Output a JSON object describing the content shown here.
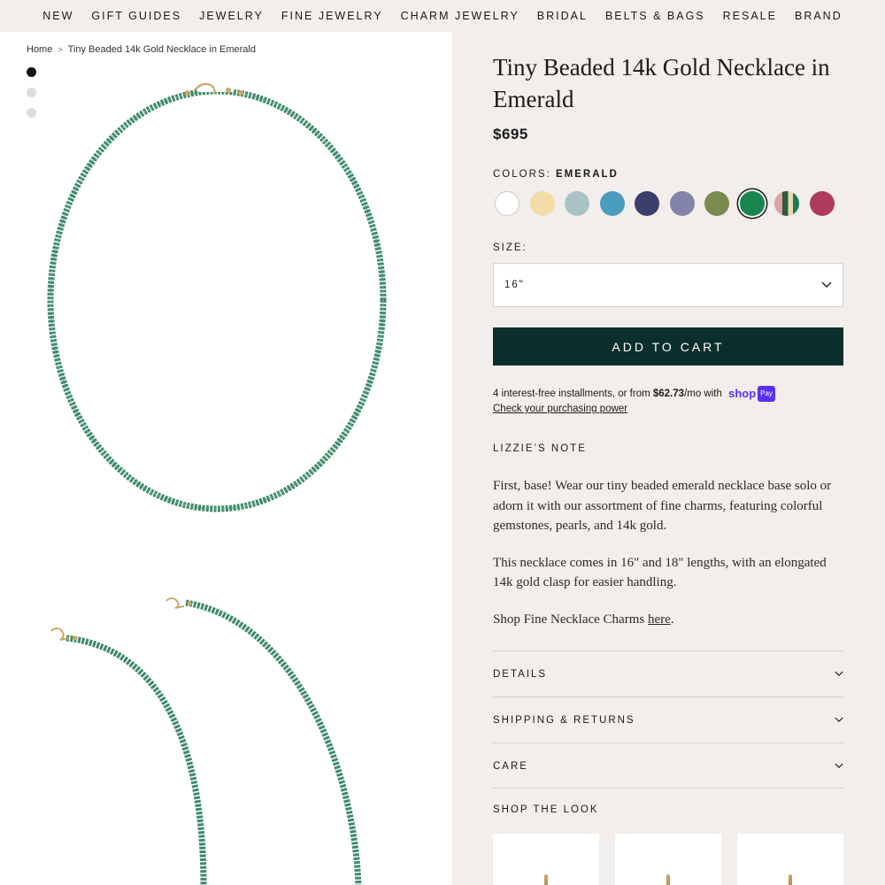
{
  "nav": {
    "items": [
      "NEW",
      "GIFT GUIDES",
      "JEWELRY",
      "FINE JEWELRY",
      "CHARM JEWELRY",
      "BRIDAL",
      "BELTS & BAGS",
      "RESALE",
      "BRAND"
    ]
  },
  "breadcrumb": {
    "home": "Home",
    "separator": ">",
    "current": "Tiny Beaded 14k Gold Necklace in Emerald"
  },
  "gallery": {
    "image_count": 3,
    "active_index": 0
  },
  "product": {
    "title": "Tiny Beaded 14k Gold Necklace in Emerald",
    "price": "$695",
    "colors_label": "COLORS:",
    "selected_color": "EMERALD",
    "swatch_colors": [
      "#ffffff",
      "#f3dca6",
      "#aac4c6",
      "#4a9cbd",
      "#3a3f6b",
      "#8284aa",
      "#7b8a50",
      "#17854f",
      "#multi",
      "#b03a5e"
    ],
    "selected_swatch_index": 7,
    "size_label": "SIZE:",
    "size_value": "16\"",
    "add_to_cart": "ADD TO CART",
    "installments_prefix": "4 interest-free installments, or from ",
    "installments_amount": "$62.73",
    "installments_suffix": "/mo with",
    "shoppay_shop": "shop",
    "shoppay_pay": "Pay",
    "purchasing_power": "Check your purchasing power"
  },
  "note": {
    "heading": "LIZZIE’S NOTE",
    "p1": "First, base! Wear our tiny beaded emerald necklace base solo or adorn it with our assortment of fine charms, featuring colorful gemstones, pearls, and 14k gold.",
    "p2": "This necklace comes in 16\" and 18\" lengths, with an elongated 14k gold clasp for easier handling.",
    "p3_prefix": "Shop Fine Necklace Charms ",
    "p3_link": "here",
    "p3_suffix": "."
  },
  "accordions": [
    "DETAILS",
    "SHIPPING & RETURNS",
    "CARE"
  ],
  "shop_the_look": {
    "heading": "SHOP THE LOOK",
    "thumb_count": 3
  },
  "colors": {
    "page_bg": "#f2eeeb",
    "button_bg": "#0a2f2c",
    "bead_green": "#3d8f6a",
    "shoppay": "#5a31f4"
  }
}
